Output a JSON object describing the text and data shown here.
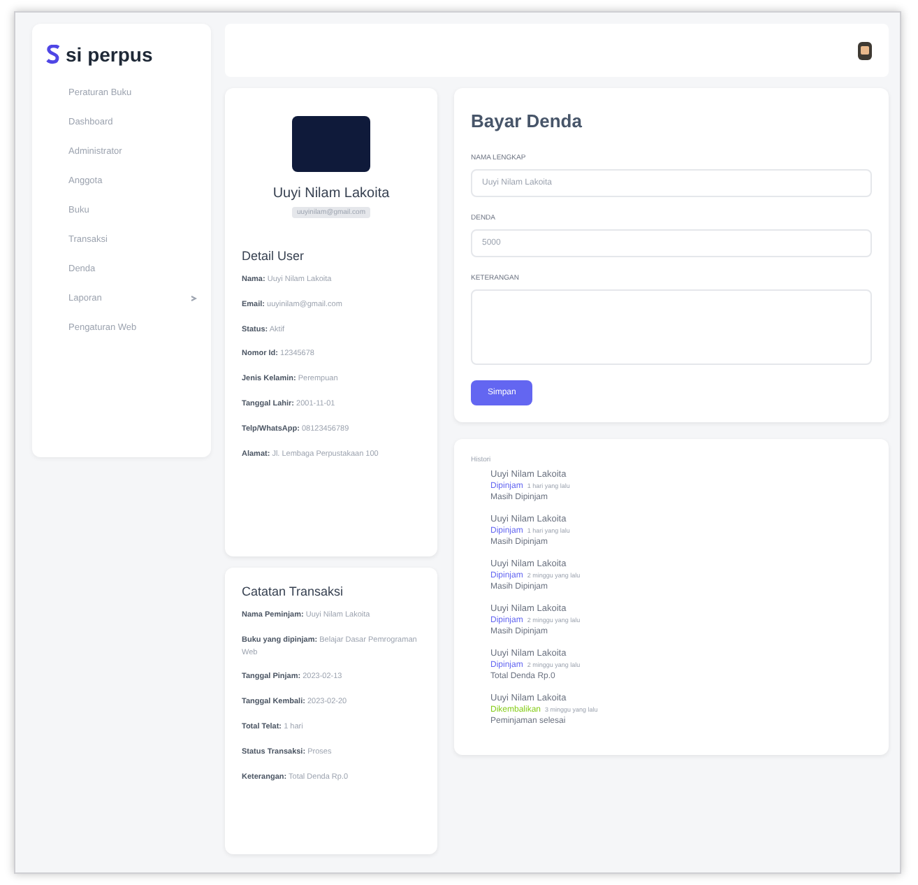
{
  "brand": {
    "name": "si perpus"
  },
  "sidebar": {
    "items": [
      {
        "label": "Peraturan Buku",
        "expandable": false
      },
      {
        "label": "Dashboard",
        "expandable": false
      },
      {
        "label": "Administrator",
        "expandable": false
      },
      {
        "label": "Anggota",
        "expandable": false
      },
      {
        "label": "Buku",
        "expandable": false
      },
      {
        "label": "Transaksi",
        "expandable": false
      },
      {
        "label": "Denda",
        "expandable": false
      },
      {
        "label": "Laporan",
        "expandable": true
      },
      {
        "label": "Pengaturan Web",
        "expandable": false
      }
    ]
  },
  "profile": {
    "name": "Uuyi Nilam Lakoita",
    "subtitle": "uuyinilam@gmail.com"
  },
  "detail_user": {
    "title": "Detail User",
    "fields": [
      {
        "label": "Nama:",
        "value": "Uuyi Nilam Lakoita"
      },
      {
        "label": "Email:",
        "value": "uuyinilam@gmail.com"
      },
      {
        "label": "Status:",
        "value": "Aktif"
      },
      {
        "label": "Nomor Id:",
        "value": "12345678"
      },
      {
        "label": "Jenis Kelamin:",
        "value": "Perempuan"
      },
      {
        "label": "Tanggal Lahir:",
        "value": "2001-11-01"
      },
      {
        "label": "Telp/WhatsApp:",
        "value": "08123456789"
      },
      {
        "label": "Alamat:",
        "value": "Jl. Lembaga Perpustakaan 100"
      }
    ]
  },
  "transaction_note": {
    "title": "Catatan Transaksi",
    "fields": [
      {
        "label": "Nama Peminjam:",
        "value": "Uuyi Nilam Lakoita"
      },
      {
        "label": "Buku yang dipinjam:",
        "value": "Belajar Dasar Pemrograman Web"
      },
      {
        "label": "Tanggal Pinjam:",
        "value": "2023-02-13"
      },
      {
        "label": "Tanggal Kembali:",
        "value": "2023-02-20"
      },
      {
        "label": "Total Telat:",
        "value": "1 hari"
      },
      {
        "label": "Status Transaksi:",
        "value": "Proses"
      },
      {
        "label": "Keterangan:",
        "value": "Total Denda Rp.0"
      }
    ]
  },
  "form": {
    "title": "Bayar Denda",
    "fields": [
      {
        "label": "NAMA LENGKAP",
        "value": "Uuyi Nilam Lakoita",
        "kind": "input"
      },
      {
        "label": "DENDA",
        "value": "5000",
        "kind": "input"
      },
      {
        "label": "KETERANGAN",
        "kind": "textarea"
      }
    ],
    "button": "Simpan"
  },
  "history": {
    "title": "Histori",
    "items": [
      {
        "name": "Uuyi Nilam Lakoita",
        "status": "Dipinjam",
        "date": "1 hari yang lalu",
        "note": "Masih Dipinjam",
        "color": "#6366f1"
      },
      {
        "name": "Uuyi Nilam Lakoita",
        "status": "Dipinjam",
        "date": "1 hari yang lalu",
        "note": "Masih Dipinjam",
        "color": "#6366f1"
      },
      {
        "name": "Uuyi Nilam Lakoita",
        "status": "Dipinjam",
        "date": "2 minggu yang lalu",
        "note": "Masih Dipinjam",
        "color": "#6366f1"
      },
      {
        "name": "Uuyi Nilam Lakoita",
        "status": "Dipinjam",
        "date": "2 minggu yang lalu",
        "note": "Masih Dipinjam",
        "color": "#6366f1"
      },
      {
        "name": "Uuyi Nilam Lakoita",
        "status": "Dipinjam",
        "date": "2 minggu yang lalu",
        "note": "Total Denda Rp.0",
        "color": "#6366f1"
      },
      {
        "name": "Uuyi Nilam Lakoita",
        "status": "Dikembalikan",
        "date": "3 minggu yang lalu",
        "note": "Peminjaman selesai",
        "color": "#84cc16"
      }
    ]
  }
}
